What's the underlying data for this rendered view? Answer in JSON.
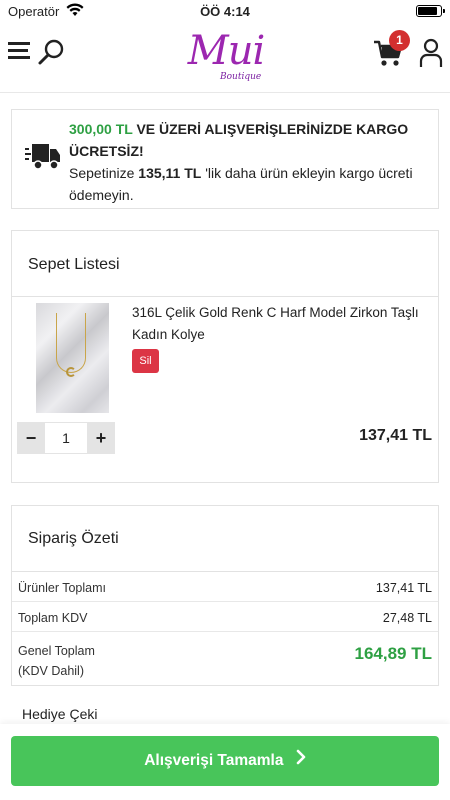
{
  "status_bar": {
    "carrier": "Operatör",
    "time": "ÖÖ 4:14"
  },
  "header": {
    "logo_text": "Mui",
    "logo_subtitle": "Boutique",
    "cart_count": "1",
    "icons": [
      "menu-icon",
      "search-icon",
      "cart-icon",
      "user-icon"
    ]
  },
  "shipping_notice": {
    "threshold": "300,00 TL",
    "headline_rest": " VE ÜZERİ ALIŞVERİŞLERİNİZDE KARGO ÜCRETSİZ!",
    "line_prefix": "Sepetinize ",
    "remaining": "135,11 TL",
    "line_suffix": " 'lik daha ürün ekleyin kargo ücreti ödemeyin."
  },
  "cart": {
    "title": "Sepet Listesi",
    "items": [
      {
        "name": "316L Çelik Gold Renk C Harf Model Zirkon Taşlı Kadın Kolye",
        "delete_label": "Sil",
        "quantity": "1",
        "minus": "−",
        "plus": "+",
        "price": "137,41 TL"
      }
    ]
  },
  "summary": {
    "title": "Sipariş Özeti",
    "rows": [
      {
        "label": "Ürünler Toplamı",
        "value": "137,41 TL"
      },
      {
        "label": "Toplam KDV",
        "value": "27,48 TL"
      }
    ],
    "grand_total_label": "Genel Toplam",
    "grand_total_note": "(KDV Dahil)",
    "grand_total_value": "164,89 TL"
  },
  "gift_voucher_label": "Hediye Çeki",
  "checkout": {
    "label": "Alışverişi Tamamla"
  },
  "colors": {
    "accent_green": "#48c55a",
    "price_green": "#2ea043",
    "brand_purple": "#9c27b0",
    "danger": "#dc3545"
  }
}
